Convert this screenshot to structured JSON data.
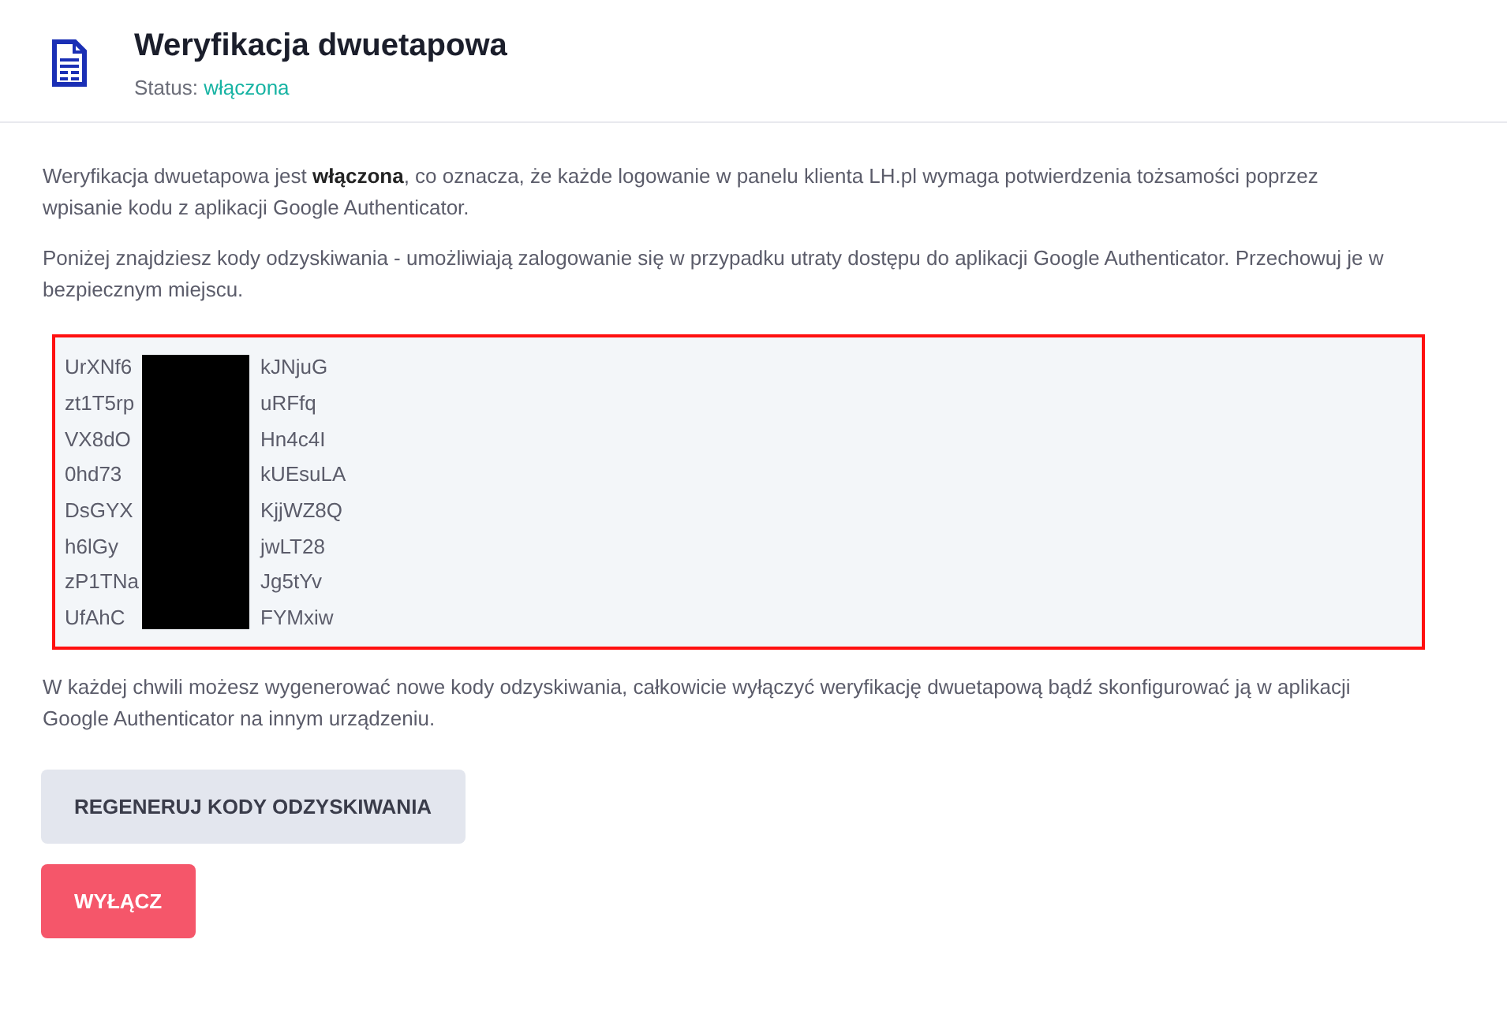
{
  "header": {
    "title": "Weryfikacja dwuetapowa",
    "status_label": "Status:",
    "status_value": "włączona"
  },
  "intro": [
    "Weryfikacja dwuetapowa jest **włączona**, co oznacza, że każde logowanie w panelu klienta LH.pl wymaga potwierdzenia tożsamości poprzez wpisanie kodu z aplikacji Google Authenticator.",
    "Poniżej znajdziesz kody odzyskiwania - umożliwiają zalogowanie się w przypadku utraty dostępu do aplikacji Google Authenticator. Przechowuj je w bezpiecznym miejscu."
  ],
  "recovery_codes": [
    {
      "start": "UrXNf6",
      "end": "kJNjuG"
    },
    {
      "start": "zt1T5rp",
      "end": "uRFfq"
    },
    {
      "start": "VX8dO",
      "end": "Hn4c4I"
    },
    {
      "start": "0hd73",
      "end": "kUEsuLA"
    },
    {
      "start": "DsGYX",
      "end": "KjjWZ8Q"
    },
    {
      "start": "h6lGy",
      "end": "jwLT28"
    },
    {
      "start": "zP1TNa",
      "end": "Jg5tYv"
    },
    {
      "start": "UfAhC",
      "end": "FYMxiw"
    }
  ],
  "note": "W każdej chwili możesz wygenerować nowe kody odzyskiwania, całkowicie wyłączyć weryfikację dwuetapową bądź skonfigurować ją w aplikacji Google Authenticator na innym urządzeniu.",
  "buttons": [
    {
      "label": "REGENERUJ KODY ODZYSKIWANIA",
      "kind": "secondary"
    },
    {
      "label": "WYŁĄCZ",
      "kind": "danger"
    }
  ]
}
